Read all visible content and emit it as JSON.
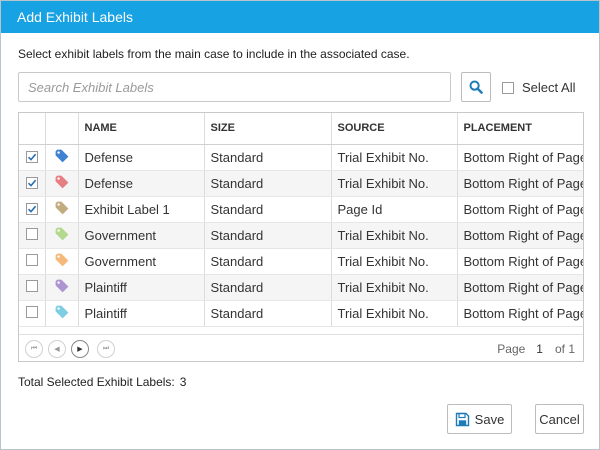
{
  "dialog": {
    "title": "Add Exhibit Labels",
    "instruction": "Select exhibit labels from the main case to include in the associated case."
  },
  "search": {
    "placeholder": "Search Exhibit Labels",
    "value": ""
  },
  "select_all": {
    "label": "Select All",
    "checked": false
  },
  "table": {
    "columns": [
      "NAME",
      "SIZE",
      "SOURCE",
      "PLACEMENT"
    ],
    "rows": [
      {
        "checked": true,
        "tag_color": "#3f82d1",
        "name": "Defense",
        "size": "Standard",
        "source": "Trial Exhibit No.",
        "placement": "Bottom Right of Page"
      },
      {
        "checked": true,
        "tag_color": "#e57f84",
        "name": "Defense",
        "size": "Standard",
        "source": "Trial Exhibit No.",
        "placement": "Bottom Right of Page"
      },
      {
        "checked": true,
        "tag_color": "#c3ab80",
        "name": "Exhibit Label 1",
        "size": "Standard",
        "source": "Page Id",
        "placement": "Bottom Right of Page"
      },
      {
        "checked": false,
        "tag_color": "#b3d88e",
        "name": "Government",
        "size": "Standard",
        "source": "Trial Exhibit No.",
        "placement": "Bottom Right of Page"
      },
      {
        "checked": false,
        "tag_color": "#f5b97c",
        "name": "Government",
        "size": "Standard",
        "source": "Trial Exhibit No.",
        "placement": "Bottom Right of Page"
      },
      {
        "checked": false,
        "tag_color": "#ad95d2",
        "name": "Plaintiff",
        "size": "Standard",
        "source": "Trial Exhibit No.",
        "placement": "Bottom Right of Page"
      },
      {
        "checked": false,
        "tag_color": "#7fcde0",
        "name": "Plaintiff",
        "size": "Standard",
        "source": "Trial Exhibit No.",
        "placement": "Bottom Right of Page"
      }
    ]
  },
  "pager": {
    "page_label": "Page",
    "current_page": "1",
    "of_label": "of 1"
  },
  "summary": {
    "label": "Total Selected Exhibit Labels:",
    "count": "3"
  },
  "buttons": {
    "save": "Save",
    "cancel": "Cancel"
  },
  "colors": {
    "titlebar": "#17a2e3",
    "accent": "#1f7bb8"
  }
}
